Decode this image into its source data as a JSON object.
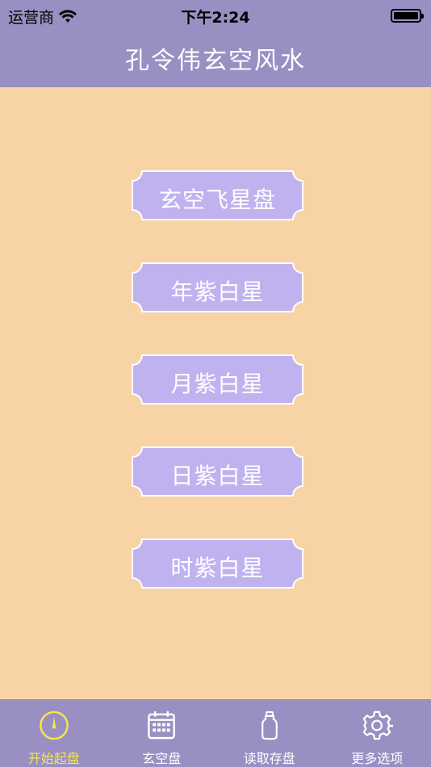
{
  "status_bar": {
    "carrier": "运营商",
    "time": "下午2:24"
  },
  "header": {
    "title": "孔令伟玄空风水"
  },
  "menu": {
    "items": [
      {
        "label": "玄空飞星盘"
      },
      {
        "label": "年紫白星"
      },
      {
        "label": "月紫白星"
      },
      {
        "label": "日紫白星"
      },
      {
        "label": "时紫白星"
      }
    ]
  },
  "tabbar": {
    "tabs": [
      {
        "label": "开始起盘",
        "icon": "compass-icon",
        "active": true
      },
      {
        "label": "玄空盘",
        "icon": "calendar-icon",
        "active": false
      },
      {
        "label": "读取存盘",
        "icon": "bottle-icon",
        "active": false
      },
      {
        "label": "更多选项",
        "icon": "gear-icon",
        "active": false
      }
    ]
  },
  "colors": {
    "header_bg": "#9a8fc2",
    "page_bg": "#f8d3a6",
    "button_fill": "#bfb2ef",
    "active_tab": "#f6e74a"
  }
}
